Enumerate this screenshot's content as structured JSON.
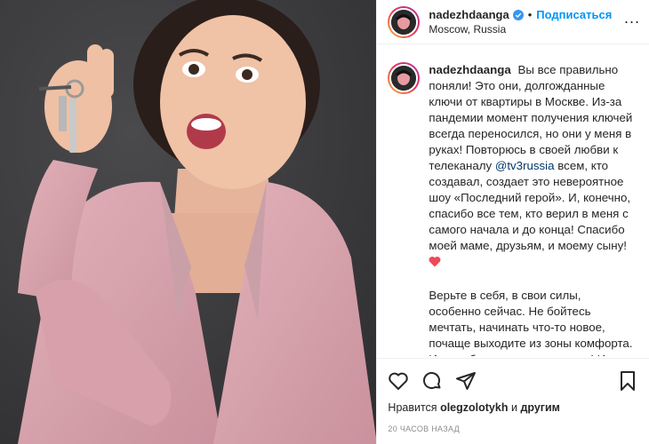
{
  "header": {
    "username": "nadezhdaanga",
    "follow_label": "Подписаться",
    "separator": "•",
    "location": "Moscow, Russia",
    "more": "..."
  },
  "caption": {
    "username": "nadezhdaanga",
    "paragraph1_part1": "Вы все правильно поняли! Это они, долгожданные ключи от квартиры в Москве. Из-за пандемии момент получения ключей всегда переносился, но они у меня в руках! Повторюсь в своей любви к телеканалу",
    "mention": "@tv3russia",
    "paragraph1_part2": "всем, кто создавал, создает это невероятное шоу «Последний герой». И, конечно, спасибо все тем, кто верил в меня с самого начала и до конца! Спасибо моей маме, друзьям, и моему сыну!",
    "paragraph2": "Верьте в себя, в свои силы, особенно сейчас. Не бойтесь мечтать, начинать что-то новое, почаще выходите из зоны комфорта. И все обязательно получится! И соглашайтесь на"
  },
  "actions": {
    "likes_prefix": "Нравится",
    "likes_user": "olegzolotykh",
    "likes_suffix": "и",
    "likes_others": "другим",
    "timestamp": "20 ЧАСОВ НАЗАД"
  },
  "colors": {
    "follow": "#0095f6",
    "mention": "#00376b",
    "heart": "#ed4956",
    "blazer": "#d9a3ad"
  }
}
